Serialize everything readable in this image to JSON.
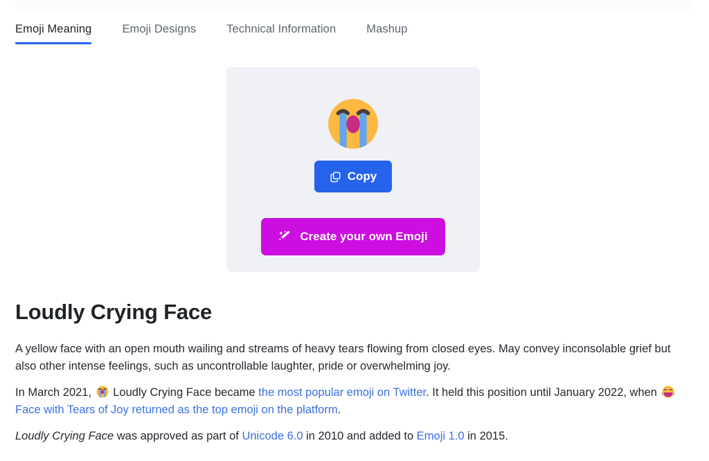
{
  "tabs": [
    {
      "label": "Emoji Meaning",
      "active": true
    },
    {
      "label": "Emoji Designs",
      "active": false
    },
    {
      "label": "Technical Information",
      "active": false
    },
    {
      "label": "Mashup",
      "active": false
    }
  ],
  "panel": {
    "hero_emoji_name": "loudly-crying-face-emoji",
    "copy_button": {
      "label": "Copy",
      "icon": "copy-icon",
      "color": "#2563eb"
    },
    "create_button": {
      "label": "Create your own Emoji",
      "icon": "magic-wand-icon",
      "color": "#cc0ee0"
    },
    "background": "#eff1f6"
  },
  "article": {
    "title": "Loudly Crying Face",
    "paragraph1": "A yellow face with an open mouth wailing and streams of heavy tears flowing from closed eyes. May convey inconsolable grief but also other intense feelings, such as uncontrollable laughter, pride or overwhelming joy.",
    "paragraph2": {
      "part1": "In March 2021,",
      "emoji1": "loudly-crying-face-emoji",
      "part2": "Loudly Crying Face became",
      "link1": "the most popular emoji on Twitter",
      "part3": ". It held this position until January 2022, when",
      "emoji2": "face-with-tears-of-joy-emoji",
      "link2": "Face with Tears of Joy returned as the top emoji on the platform",
      "part4": "."
    },
    "paragraph3": {
      "italic1": "Loudly Crying Face",
      "part1": "was approved as part of",
      "link1": "Unicode 6.0",
      "part2": "in 2010 and added to",
      "link2": "Emoji 1.0",
      "part3": "in 2015."
    }
  },
  "colors": {
    "accent_blue": "#2563eb",
    "link_blue": "#3b6fe0",
    "magenta": "#cc0ee0",
    "panel_bg": "#eff1f6",
    "text": "#24292f"
  }
}
